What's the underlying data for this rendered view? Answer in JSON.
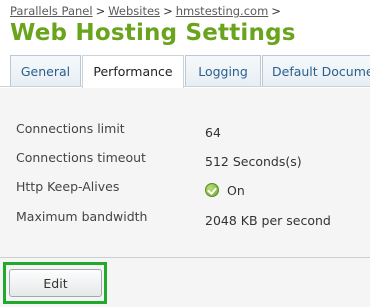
{
  "breadcrumb": {
    "items": [
      {
        "label": "Parallels Panel"
      },
      {
        "label": "Websites"
      },
      {
        "label": "hmstesting.com"
      }
    ],
    "separator": ">"
  },
  "page_title": "Web Hosting Settings",
  "tabs": [
    {
      "label": "General",
      "active": false
    },
    {
      "label": "Performance",
      "active": true
    },
    {
      "label": "Logging",
      "active": false
    },
    {
      "label": "Default Document",
      "active": false
    }
  ],
  "settings": [
    {
      "label": "Connections limit",
      "value": "64"
    },
    {
      "label": "Connections timeout",
      "value": "512 Seconds(s)"
    },
    {
      "label": "Http Keep-Alives",
      "value": "On",
      "icon": "check-circle-icon",
      "icon_color": "#6ea62a"
    },
    {
      "label": "Maximum bandwidth",
      "value": "2048 KB per second"
    }
  ],
  "actions": {
    "edit_label": "Edit"
  },
  "colors": {
    "title": "#6aa31c",
    "tab_text": "#2a5f8e",
    "highlight": "#1faa2c",
    "panel_bg": "#f5f5f5"
  }
}
